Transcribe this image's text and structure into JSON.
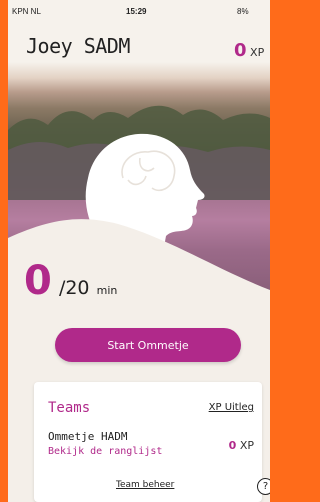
{
  "status_bar": {
    "carrier": "KPN NL",
    "time": "15:29",
    "battery": "8%"
  },
  "header": {
    "user_name": "Joey SADM",
    "xp_value": "0",
    "xp_unit": "XP"
  },
  "progress": {
    "minutes": "0",
    "goal": "/20",
    "unit": "min"
  },
  "start_button": "Start Ommetje",
  "teams": {
    "title": "Teams",
    "xp_link": "XP Uitleg",
    "team_name": "Ommetje HADM",
    "leaderboard_link": "Bekijk de ranglijst",
    "team_xp_value": "0",
    "team_xp_unit": "XP",
    "manage_link": "Team beheer"
  },
  "help_icon": "question-icon",
  "colors": {
    "accent": "#b0298a",
    "frame": "#ff6b1a",
    "background": "#f4efe9"
  }
}
